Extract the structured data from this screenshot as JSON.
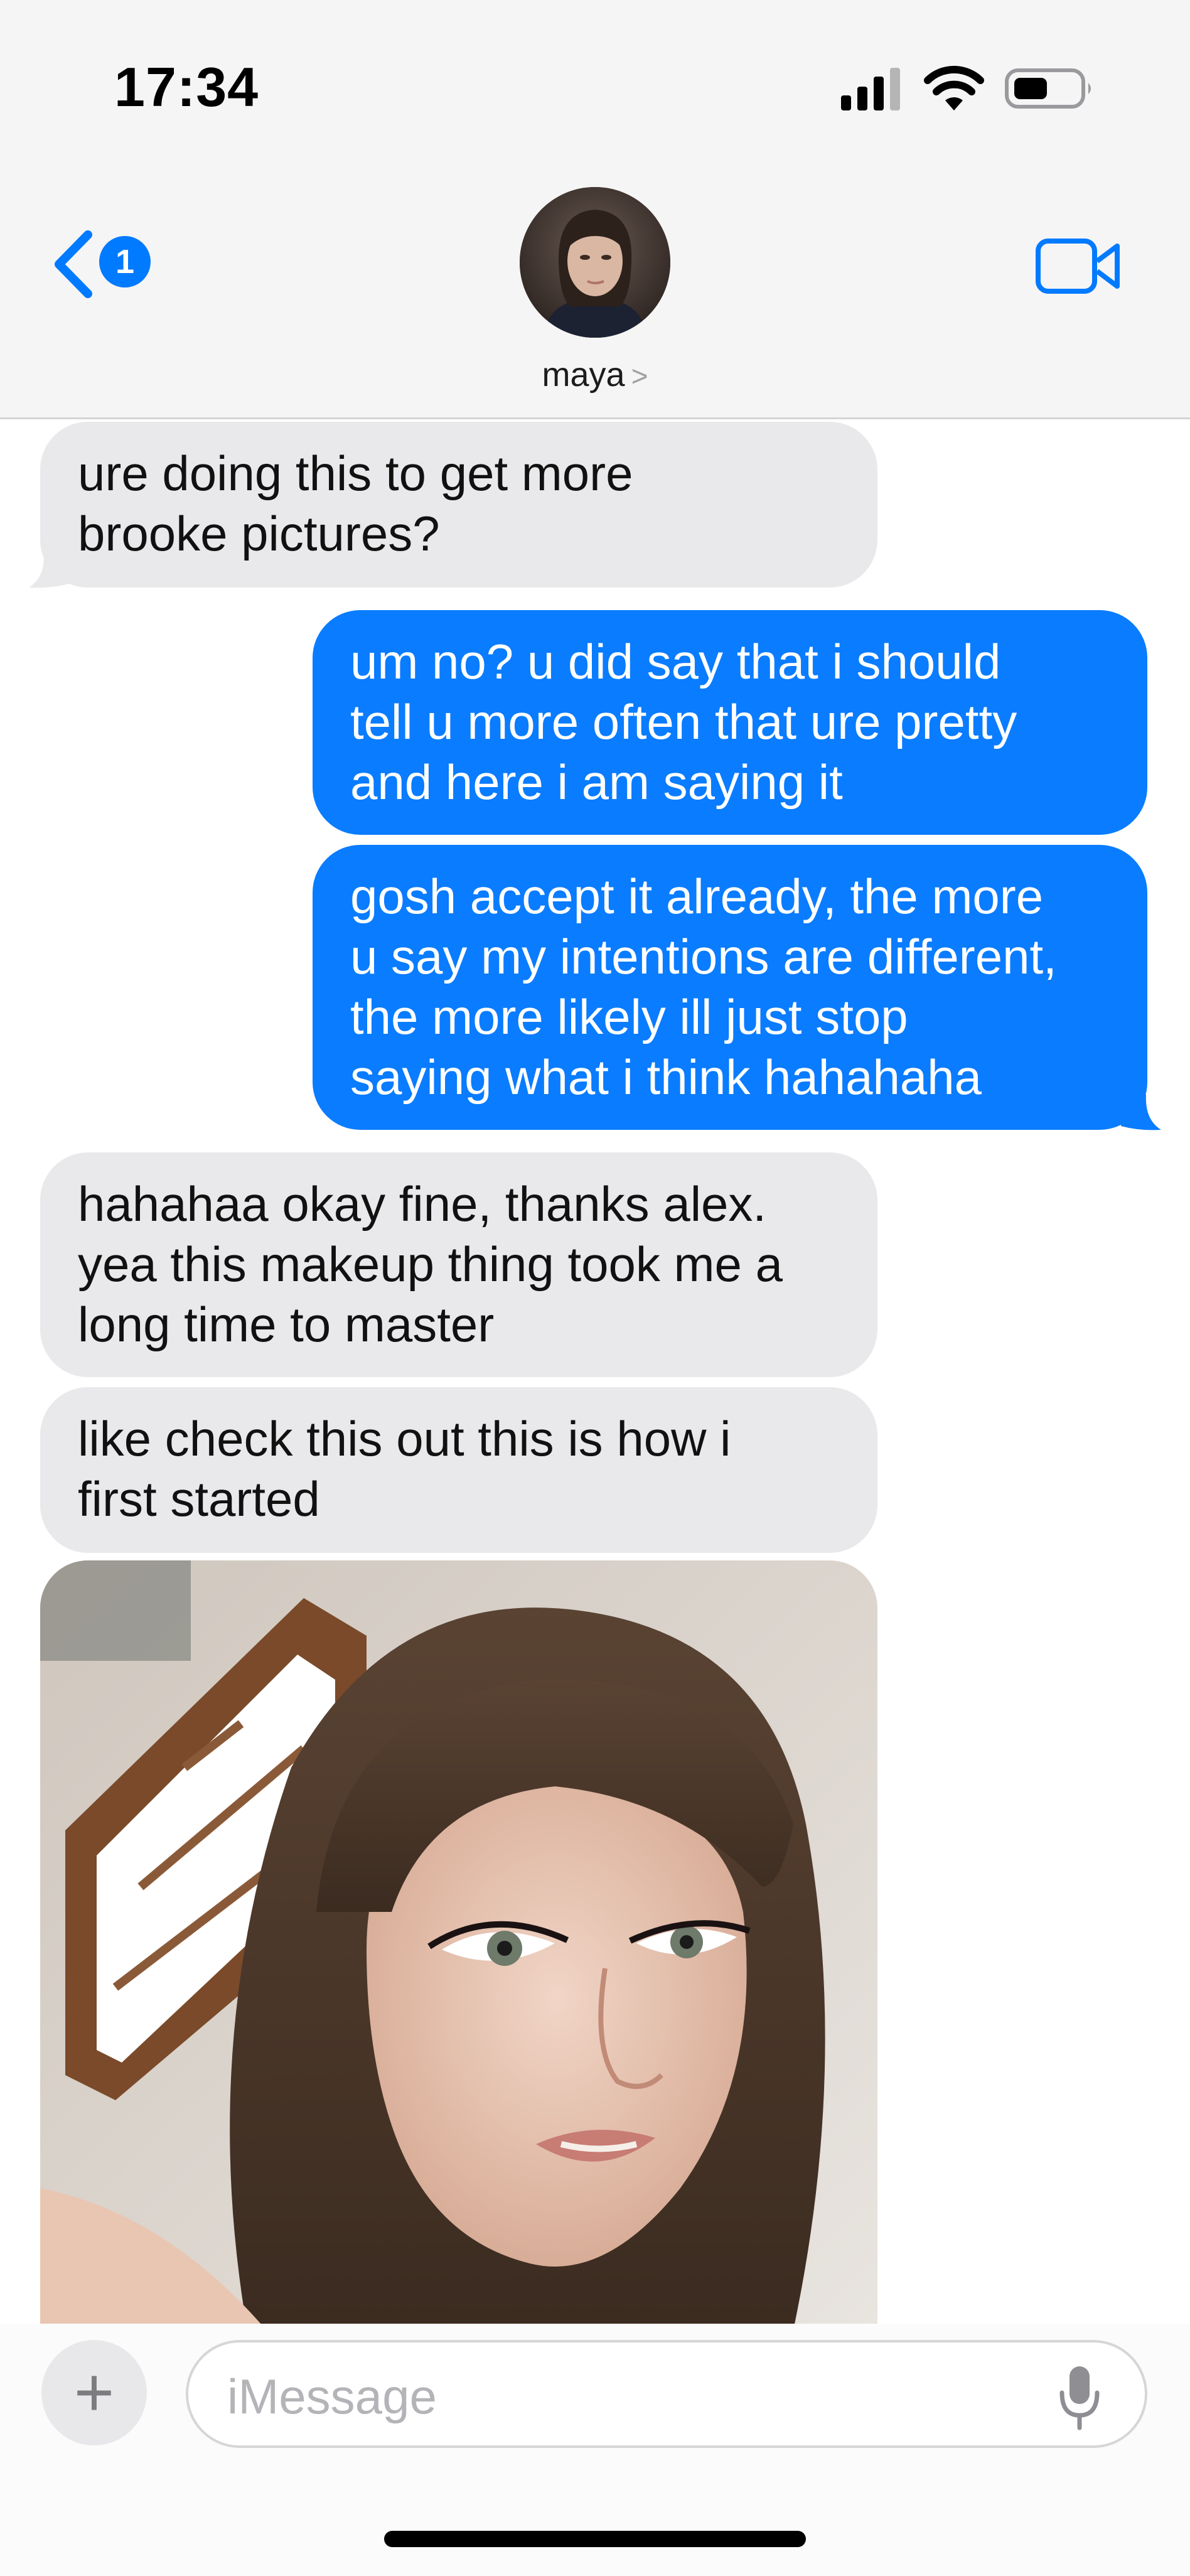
{
  "status_bar": {
    "time": "17:34"
  },
  "header": {
    "back_badge": "1",
    "contact_name": "maya",
    "contact_chevron": ">"
  },
  "messages": [
    {
      "direction": "received",
      "lines": [
        "ure doing this to get more",
        "brooke pictures?"
      ]
    },
    {
      "direction": "sent",
      "lines": [
        "um no? u did say that i should",
        "tell u more often that ure pretty",
        "and here i am saying it"
      ]
    },
    {
      "direction": "sent",
      "lines": [
        "gosh accept it already, the more",
        "u say my intentions are different,",
        "the more likely ill just stop",
        "saying what i think hahahaha"
      ]
    },
    {
      "direction": "received",
      "lines": [
        "hahahaa okay fine, thanks alex.",
        "yea this makeup thing took me a",
        "long time to master"
      ]
    },
    {
      "direction": "received",
      "lines": [
        "like check this out this is how i",
        "first started"
      ]
    }
  ],
  "composer": {
    "placeholder": "iMessage",
    "plus_label": "+"
  },
  "colors": {
    "sent_bubble": "#0a7cff",
    "received_bubble": "#e9e9eb",
    "accent": "#007aff"
  },
  "icons": [
    "back-chevron-icon",
    "facetime-video-icon",
    "signal-icon",
    "wifi-icon",
    "battery-icon",
    "microphone-icon"
  ]
}
